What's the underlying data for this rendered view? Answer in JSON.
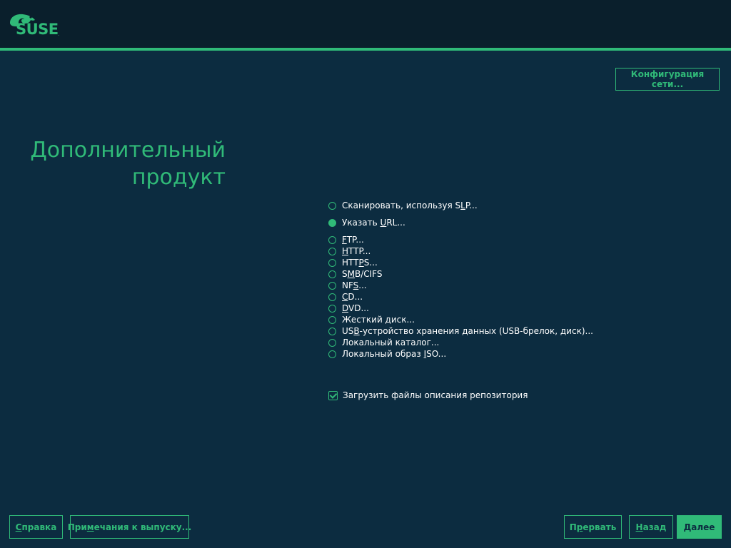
{
  "brand": {
    "name": "SUSE",
    "accent": "#30ba78",
    "background": "#0c2c40",
    "topbar": "#0a1f2c"
  },
  "header": {
    "logo_icon": "chameleon-logo-icon",
    "logo_text": "SUSE",
    "logo_mark": "."
  },
  "network_button": {
    "label": "Конфигурация сети..."
  },
  "page_title": {
    "line1": "Дополнительный",
    "line2": "продукт"
  },
  "options": [
    {
      "pre": "Сканировать, используя S",
      "u": "L",
      "post": "P...",
      "checked": false
    },
    {
      "pre": "Указать ",
      "u": "U",
      "post": "RL...",
      "checked": true
    },
    {
      "pre": "",
      "u": "F",
      "post": "TP...",
      "checked": false
    },
    {
      "pre": "",
      "u": "H",
      "post": "TTP...",
      "checked": false
    },
    {
      "pre": "HTT",
      "u": "P",
      "post": "S...",
      "checked": false
    },
    {
      "pre": "S",
      "u": "M",
      "post": "B/CIFS",
      "checked": false
    },
    {
      "pre": "NF",
      "u": "S",
      "post": "...",
      "checked": false
    },
    {
      "pre": "",
      "u": "C",
      "post": "D...",
      "checked": false
    },
    {
      "pre": "",
      "u": "D",
      "post": "VD...",
      "checked": false
    },
    {
      "pre": "Жесткий диск...",
      "u": "",
      "post": "",
      "checked": false
    },
    {
      "pre": "US",
      "u": "B",
      "post": "-устройство хранения данных (USB-брелок, диск)...",
      "checked": false
    },
    {
      "pre": "Локальный каталог...",
      "u": "",
      "post": "",
      "checked": false
    },
    {
      "pre": "Локальный образ ",
      "u": "I",
      "post": "SO...",
      "checked": false
    }
  ],
  "download_checkbox": {
    "label": "Загрузить файлы описания репозитория",
    "checked": true
  },
  "footer": {
    "help": {
      "u": "С",
      "post": "правка"
    },
    "release_notes": {
      "pre": "При",
      "u": "м",
      "post": "ечания к выпуску..."
    },
    "abort": {
      "pre": "П",
      "u": "р",
      "post": "ервать"
    },
    "back": {
      "u": "Н",
      "post": "азад"
    },
    "next": {
      "u": "Д",
      "post": "алее"
    }
  }
}
